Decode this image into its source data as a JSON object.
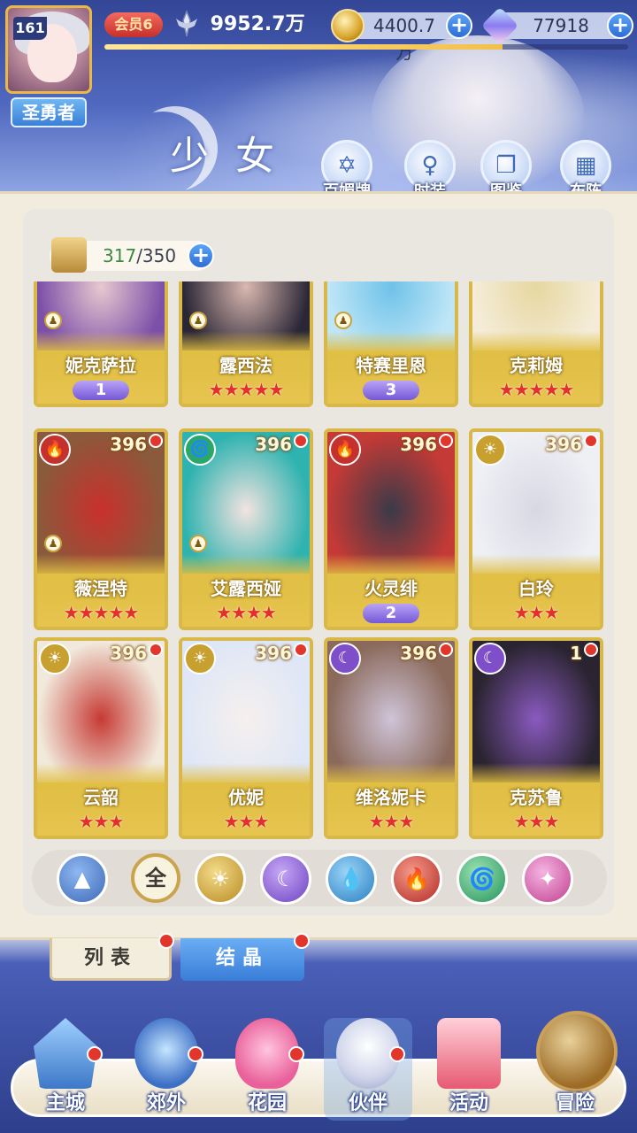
{
  "player": {
    "level": "161",
    "title": "圣勇者",
    "vip": "会员6",
    "power": "9952.7万",
    "xp_fraction": 0.76
  },
  "resources": {
    "gold": "4400.7万",
    "gems": "77918"
  },
  "header": {
    "section_title": "少女",
    "buttons": [
      {
        "label": "百媚牌",
        "icon": "hexagram-card-icon"
      },
      {
        "label": "时装",
        "icon": "dress-icon"
      },
      {
        "label": "图鉴",
        "icon": "book-icon"
      },
      {
        "label": "布阵",
        "icon": "grid-formation-icon"
      }
    ]
  },
  "capacity": {
    "used": "317",
    "total": "/350"
  },
  "cards": [
    {
      "name": "妮克萨拉",
      "rank": "1",
      "stars": "",
      "level": "",
      "element": "",
      "art": [
        "#7c4fa8",
        "#e8c8d0"
      ],
      "pawn": true
    },
    {
      "name": "露西法",
      "rank": "",
      "stars": "★★★★★",
      "level": "",
      "element": "",
      "art": [
        "#2a2636",
        "#d9b8b0"
      ],
      "pawn": true
    },
    {
      "name": "特赛里恩",
      "rank": "3",
      "stars": "",
      "level": "",
      "element": "",
      "art": [
        "#bfe6f7",
        "#6fc2e8"
      ],
      "pawn": true
    },
    {
      "name": "克莉姆",
      "rank": "",
      "stars": "★★★★★",
      "level": "",
      "element": "",
      "art": [
        "#f4ecd8",
        "#e7d7a0"
      ],
      "pawn": false
    },
    {
      "name": "薇涅特",
      "rank": "",
      "stars": "★★★★★",
      "level": "396",
      "element": "fire",
      "art": [
        "#8a5a3c",
        "#c9302b"
      ],
      "pawn": true
    },
    {
      "name": "艾露西娅",
      "rank": "",
      "stars": "★★★★",
      "level": "396",
      "element": "wind",
      "art": [
        "#2fb3b0",
        "#f3e3e0"
      ],
      "pawn": true
    },
    {
      "name": "火灵绯",
      "rank": "2",
      "stars": "",
      "level": "396",
      "element": "fire",
      "art": [
        "#c43a36",
        "#3a3a48"
      ],
      "pawn": false
    },
    {
      "name": "白玲",
      "rank": "",
      "stars": "★★★",
      "level": "396",
      "element": "light",
      "art": [
        "#eef0f4",
        "#d8d8e4"
      ],
      "pawn": false
    },
    {
      "name": "云韶",
      "rank": "",
      "stars": "★★★",
      "level": "396",
      "element": "light",
      "art": [
        "#f1eadc",
        "#c63a34"
      ],
      "pawn": false
    },
    {
      "name": "优妮",
      "rank": "",
      "stars": "★★★",
      "level": "396",
      "element": "light",
      "art": [
        "#dfe7f6",
        "#f6f0ee"
      ],
      "pawn": false
    },
    {
      "name": "维洛妮卡",
      "rank": "",
      "stars": "★★★",
      "level": "396",
      "element": "dark",
      "art": [
        "#8b6a5c",
        "#cfc4d8"
      ],
      "pawn": false
    },
    {
      "name": "克苏鲁",
      "rank": "",
      "stars": "★★★",
      "level": "1",
      "element": "dark",
      "art": [
        "#2a2430",
        "#8a5ac0"
      ],
      "pawn": false
    }
  ],
  "filters": [
    {
      "key": "up",
      "label": "▲",
      "icon": "chevron-up-icon"
    },
    {
      "key": "all",
      "label": "全",
      "icon": "all-icon"
    },
    {
      "key": "light",
      "label": "☀",
      "icon": "light-element-icon"
    },
    {
      "key": "dark",
      "label": "☾",
      "icon": "dark-element-icon"
    },
    {
      "key": "water",
      "label": "💧",
      "icon": "water-element-icon"
    },
    {
      "key": "fire",
      "label": "🔥",
      "icon": "fire-element-icon"
    },
    {
      "key": "wind",
      "label": "🌀",
      "icon": "wind-element-icon"
    },
    {
      "key": "star",
      "label": "✦",
      "icon": "star-element-icon"
    }
  ],
  "subtabs": {
    "list": "列表",
    "crystal": "结晶"
  },
  "nav": [
    {
      "label": "主城",
      "dot": true
    },
    {
      "label": "郊外",
      "dot": true
    },
    {
      "label": "花园",
      "dot": true
    },
    {
      "label": "伙伴",
      "dot": true
    },
    {
      "label": "活动",
      "dot": false
    },
    {
      "label": "冒险",
      "dot": false
    }
  ],
  "element_glyphs": {
    "fire": "🔥",
    "wind": "🌀",
    "light": "☀",
    "dark": "☾"
  }
}
